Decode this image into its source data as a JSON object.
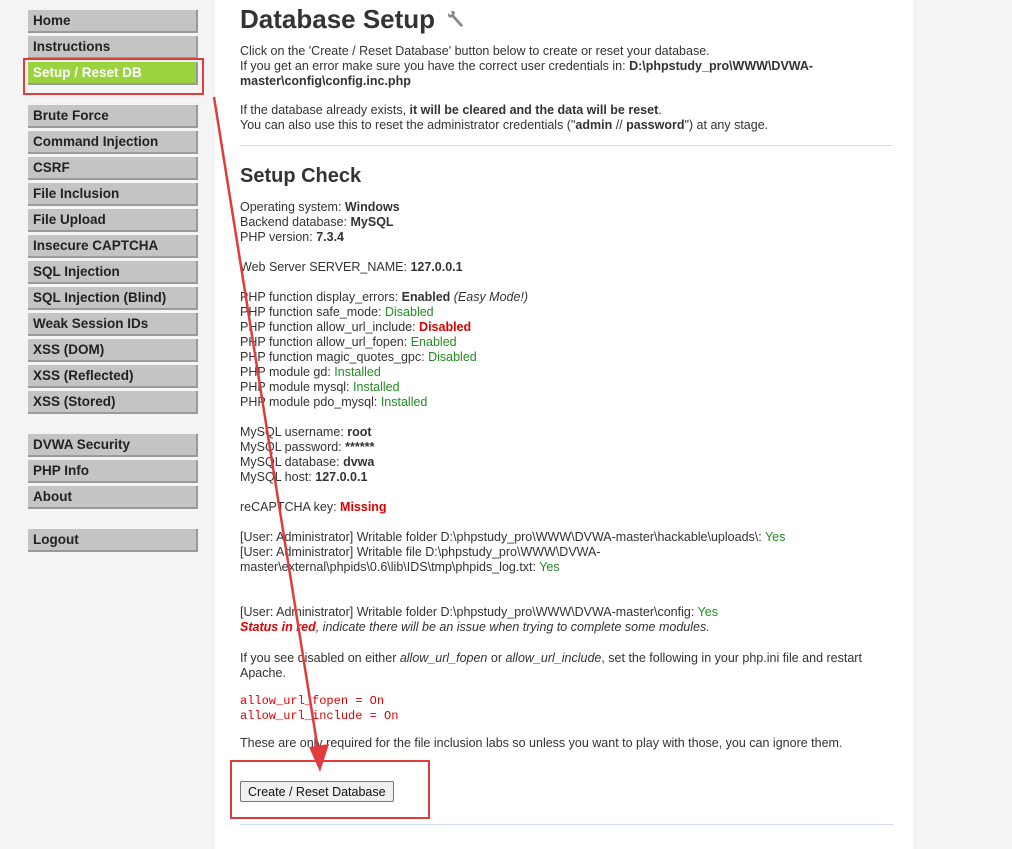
{
  "menu": {
    "group1": [
      "Home",
      "Instructions",
      "Setup / Reset DB"
    ],
    "group2": [
      "Brute Force",
      "Command Injection",
      "CSRF",
      "File Inclusion",
      "File Upload",
      "Insecure CAPTCHA",
      "SQL Injection",
      "SQL Injection (Blind)",
      "Weak Session IDs",
      "XSS (DOM)",
      "XSS (Reflected)",
      "XSS (Stored)"
    ],
    "group3": [
      "DVWA Security",
      "PHP Info",
      "About"
    ],
    "group4": [
      "Logout"
    ]
  },
  "page": {
    "title": "Database Setup",
    "intro1": "Click on the 'Create / Reset Database' button below to create or reset your database.",
    "intro2_pre": "If you get an error make sure you have the correct user credentials in: ",
    "intro2_path1": "D:\\phpstudy_pro\\WWW\\DVWA-",
    "intro2_path2": "master\\config\\config.inc.php",
    "intro3_pre": "If the database already exists, ",
    "intro3_bold": "it will be cleared and the data will be reset",
    "intro3_post": ".",
    "intro4_pre": "You can also use this to reset the administrator credentials (\"",
    "intro4_admin": "admin",
    "intro4_sep": " // ",
    "intro4_password": "password",
    "intro4_post": "\") at any stage.",
    "setup_check": "Setup Check",
    "os_label": "Operating system: ",
    "os_value": "Windows",
    "backend_label": "Backend database: ",
    "backend_value": "MySQL",
    "php_label": "PHP version: ",
    "php_value": "7.3.4",
    "server_label": "Web Server SERVER_NAME: ",
    "server_value": "127.0.0.1",
    "display_errors_label": "PHP function display_errors: ",
    "display_errors_value": "Enabled",
    "display_errors_note": " (Easy Mode!)",
    "safe_mode_label": "PHP function safe_mode: ",
    "safe_mode_value": "Disabled",
    "allow_url_include_label": "PHP function allow_url_include: ",
    "allow_url_include_value": "Disabled",
    "allow_url_fopen_label": "PHP function allow_url_fopen: ",
    "allow_url_fopen_value": "Enabled",
    "magic_quotes_label": "PHP function magic_quotes_gpc: ",
    "magic_quotes_value": "Disabled",
    "gd_label": "PHP module gd: ",
    "gd_value": "Installed",
    "mysql_label": "PHP module mysql: ",
    "mysql_value": "Installed",
    "pdo_label": "PHP module pdo_mysql: ",
    "pdo_value": "Installed",
    "db_user_label": "MySQL username: ",
    "db_user_value": "root",
    "db_pass_label": "MySQL password: ",
    "db_pass_value": "******",
    "db_name_label": "MySQL database: ",
    "db_name_value": "dvwa",
    "db_host_label": "MySQL host: ",
    "db_host_value": "127.0.0.1",
    "recaptcha_label": "reCAPTCHA key: ",
    "recaptcha_value": "Missing",
    "uploads_text": "[User: Administrator] Writable folder D:\\phpstudy_pro\\WWW\\DVWA-master\\hackable\\uploads\\: ",
    "uploads_value": "Yes",
    "phpids_text1": "[User: Administrator] Writable file D:\\phpstudy_pro\\WWW\\DVWA-",
    "phpids_text2": "master\\external\\phpids\\0.6\\lib\\IDS\\tmp\\phpids_log.txt: ",
    "phpids_value": "Yes",
    "config_text": "[User: Administrator] Writable folder D:\\phpstudy_pro\\WWW\\DVWA-master\\config: ",
    "config_value": "Yes",
    "status_red": "Status in red",
    "status_note": ", indicate there will be an issue when trying to complete some modules.",
    "disabled_note_pre": "If you see disabled on either ",
    "disabled_note_fopen": "allow_url_fopen",
    "disabled_note_or": " or ",
    "disabled_note_include": "allow_url_include",
    "disabled_note_post1": ", set the following in your php.ini file and restart",
    "disabled_note_post2": "Apache.",
    "code1": "allow_url_fopen = On",
    "code2": "allow_url_include = On",
    "labs_note": "These are only required for the file inclusion labs so unless you want to play with those, you can ignore them.",
    "button_label": "Create / Reset Database"
  },
  "colors": {
    "selected_menu": "#9ad33e",
    "menu_bg": "#c4c4c4",
    "ok_green": "#238c23",
    "error_red": "#e00000",
    "annotation_red": "#e03c3c"
  },
  "icons": {
    "title_icon": "wrench-icon"
  }
}
